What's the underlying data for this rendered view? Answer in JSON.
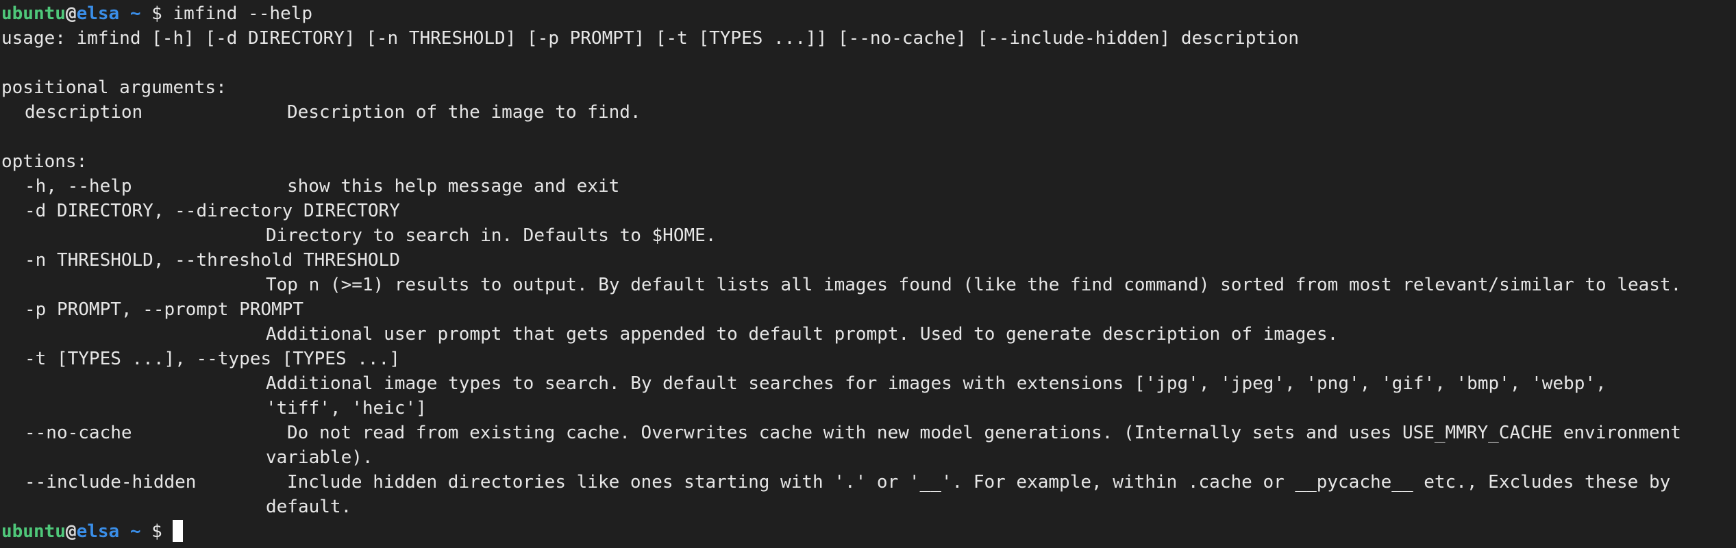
{
  "prompt": {
    "user": "ubuntu",
    "at": "@",
    "host": "elsa",
    "path": "~",
    "symbol": "$"
  },
  "command": "imfind --help",
  "usage": "usage: imfind [-h] [-d DIRECTORY] [-n THRESHOLD] [-p PROMPT] [-t [TYPES ...]] [--no-cache] [--include-hidden] description",
  "positional_header": "positional arguments:",
  "positional": [
    {
      "name": "description",
      "help": "Description of the image to find."
    }
  ],
  "options_header": "options:",
  "options": [
    {
      "flag": "-h, --help",
      "help": "show this help message and exit"
    },
    {
      "flag": "-d DIRECTORY, --directory DIRECTORY",
      "help": "Directory to search in. Defaults to $HOME."
    },
    {
      "flag": "-n THRESHOLD, --threshold THRESHOLD",
      "help": "Top n (>=1) results to output. By default lists all images found (like the find command) sorted from most relevant/similar to least."
    },
    {
      "flag": "-p PROMPT, --prompt PROMPT",
      "help": "Additional user prompt that gets appended to default prompt. Used to generate description of images."
    },
    {
      "flag": "-t [TYPES ...], --types [TYPES ...]",
      "help": "Additional image types to search. By default searches for images with extensions ['jpg', 'jpeg', 'png', 'gif', 'bmp', 'webp',",
      "help_cont": "'tiff', 'heic']"
    },
    {
      "flag": "--no-cache",
      "help": "Do not read from existing cache. Overwrites cache with new model generations. (Internally sets and uses USE_MMRY_CACHE environment",
      "help_cont": "variable)."
    },
    {
      "flag": "--include-hidden",
      "help": "Include hidden directories like ones starting with '.' or '__'. For example, within .cache or __pycache__ etc., Excludes these by",
      "help_cont": "default."
    }
  ]
}
